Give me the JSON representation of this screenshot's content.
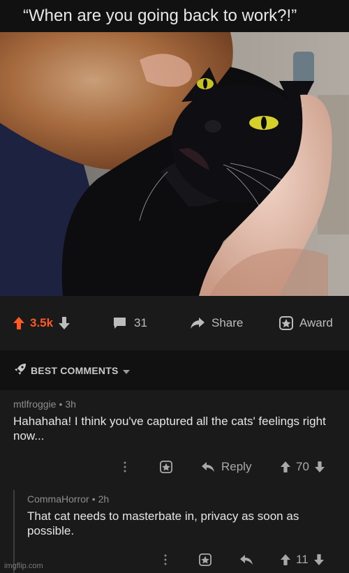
{
  "post": {
    "title": "“When are you going back to work?!”",
    "upvotes": "3.5k",
    "comments_count": "31",
    "share_label": "Share",
    "award_label": "Award"
  },
  "sort": {
    "label": "BEST COMMENTS"
  },
  "comments": [
    {
      "author": "mtlfroggie",
      "age": "3h",
      "text": "Hahahaha! I think you've captured all the cats' feelings right now...",
      "reply_label": "Reply",
      "score": "70"
    },
    {
      "author": "CommaHorror",
      "age": "2h",
      "text": "That cat needs to masterbate in, privacy as soon as possible.",
      "score": "11"
    }
  ],
  "watermark": "imgflip.com",
  "colors": {
    "upvote": "#ff5a24",
    "background": "#1a1a1b"
  },
  "icons": [
    "upvote-icon",
    "downvote-icon",
    "comment-icon",
    "share-icon",
    "award-icon",
    "rocket-icon",
    "more-icon",
    "reply-icon"
  ]
}
